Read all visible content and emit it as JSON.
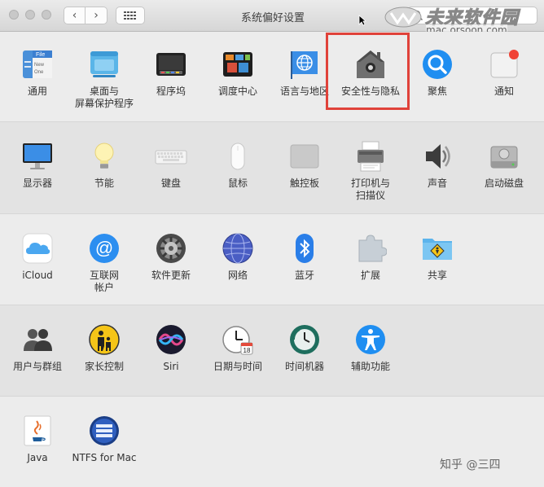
{
  "window": {
    "title": "系统偏好设置"
  },
  "toolbar": {
    "back_glyph": "‹",
    "forward_glyph": "›"
  },
  "watermark": {
    "brand": "未来软件园",
    "url": "mac.orsoon.com"
  },
  "file_icon_text": {
    "line1": "File",
    "line2": "New",
    "line3": "One"
  },
  "calendar_day": "18",
  "sections": [
    {
      "items": [
        {
          "id": "general",
          "label": "通用"
        },
        {
          "id": "desktop",
          "label1": "桌面与",
          "label2": "屏幕保护程序"
        },
        {
          "id": "dock",
          "label": "程序坞"
        },
        {
          "id": "mission-control",
          "label": "调度中心"
        },
        {
          "id": "language",
          "label": "语言与地区"
        },
        {
          "id": "security",
          "label": "安全性与隐私"
        },
        {
          "id": "spotlight",
          "label": "聚焦"
        },
        {
          "id": "notifications",
          "label": "通知"
        }
      ]
    },
    {
      "items": [
        {
          "id": "displays",
          "label": "显示器"
        },
        {
          "id": "energy",
          "label": "节能"
        },
        {
          "id": "keyboard",
          "label": "键盘"
        },
        {
          "id": "mouse",
          "label": "鼠标"
        },
        {
          "id": "trackpad",
          "label": "触控板"
        },
        {
          "id": "printers",
          "label1": "打印机与",
          "label2": "扫描仪"
        },
        {
          "id": "sound",
          "label": "声音"
        },
        {
          "id": "startup",
          "label": "启动磁盘"
        }
      ]
    },
    {
      "items": [
        {
          "id": "icloud",
          "label": "iCloud"
        },
        {
          "id": "internet-accounts",
          "label1": "互联网",
          "label2": "帐户"
        },
        {
          "id": "software-update",
          "label": "软件更新"
        },
        {
          "id": "network",
          "label": "网络"
        },
        {
          "id": "bluetooth",
          "label": "蓝牙"
        },
        {
          "id": "extensions",
          "label": "扩展"
        },
        {
          "id": "sharing",
          "label": "共享"
        }
      ]
    },
    {
      "items": [
        {
          "id": "users",
          "label": "用户与群组"
        },
        {
          "id": "parental",
          "label": "家长控制"
        },
        {
          "id": "siri",
          "label": "Siri"
        },
        {
          "id": "datetime",
          "label": "日期与时间"
        },
        {
          "id": "timemachine",
          "label": "时间机器"
        },
        {
          "id": "accessibility",
          "label": "辅助功能"
        }
      ]
    },
    {
      "items": [
        {
          "id": "java",
          "label": "Java"
        },
        {
          "id": "ntfs",
          "label": "NTFS for Mac"
        }
      ]
    }
  ],
  "footer_watermark": "知乎 @三四",
  "colors": {
    "highlight": "#e0423a",
    "accent_blue": "#1f8ef1"
  }
}
